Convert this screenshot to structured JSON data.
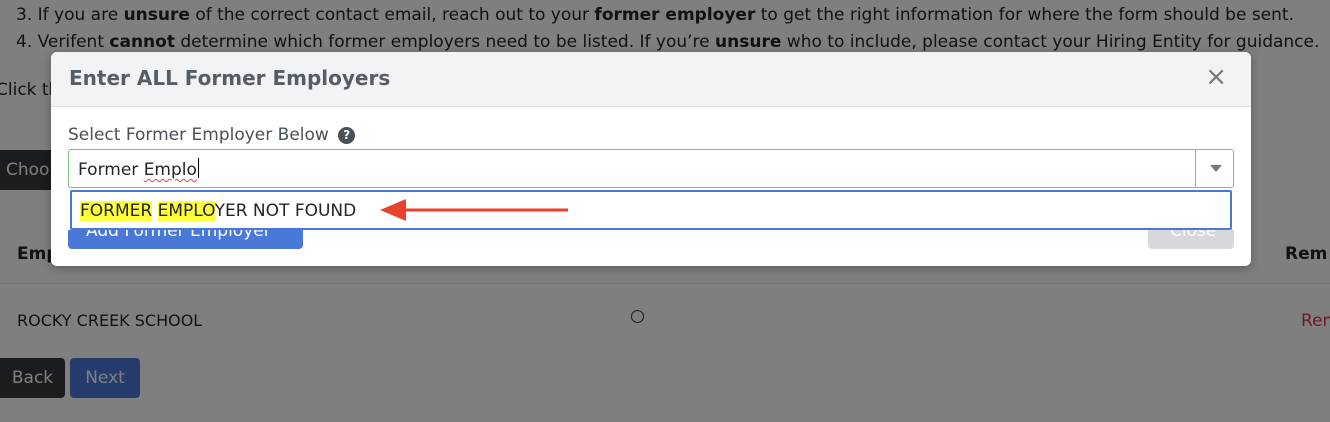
{
  "instructions": [
    {
      "num": "3.",
      "parts": [
        {
          "t": "If you are ",
          "b": false
        },
        {
          "t": "unsure",
          "b": true
        },
        {
          "t": " of the correct contact email, reach out to your ",
          "b": false
        },
        {
          "t": "former employer",
          "b": true
        },
        {
          "t": " to get the right information for where the form should be sent.",
          "b": false
        }
      ]
    },
    {
      "num": "4.",
      "parts": [
        {
          "t": "Verifent ",
          "b": false
        },
        {
          "t": "cannot",
          "b": true
        },
        {
          "t": " determine which former employers need to be listed. If you’re ",
          "b": false
        },
        {
          "t": "unsure",
          "b": true
        },
        {
          "t": " who to include, please contact your Hiring Entity for guidance.",
          "b": false
        }
      ]
    }
  ],
  "background": {
    "click_text": "Click th",
    "choose_button": "Choo",
    "table_headers": {
      "employer": "Emp",
      "remove": "Rem"
    },
    "rows": [
      {
        "employer": "ROCKY CREEK SCHOOL",
        "remove": "Rem"
      }
    ],
    "back_button": "Back",
    "next_button": "Next"
  },
  "modal": {
    "title": "Enter ALL Former Employers",
    "close_symbol": "×",
    "field_label": "Select Former Employer Below",
    "help_symbol": "?",
    "input_value_plain": "Former ",
    "input_value_misspelled": "Emplo",
    "dropdown_option": {
      "highlight1": "FORMER",
      "space": " ",
      "highlight2": "EMPLO",
      "rest": "YER NOT FOUND"
    },
    "add_button_label": "Add Former Employer",
    "close_button_label": "Close"
  },
  "annotation": {
    "arrow_color": "#e8412c"
  }
}
